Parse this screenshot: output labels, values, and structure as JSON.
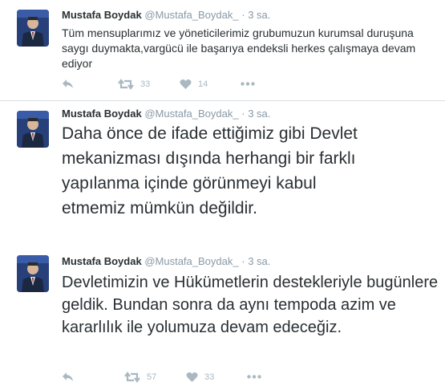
{
  "tweets": [
    {
      "name": "Mustafa Boydak",
      "handle": "@Mustafa_Boydak_",
      "dot": "·",
      "time": "3 sa.",
      "text": "Tüm mensuplarımız ve yöneticilerimiz grubumuzun kurumsal duruşuna saygı duymakta,vargücü ile başarıya endeksli herkes çalışmaya devam ediyor",
      "retweets": "33",
      "likes": "14"
    },
    {
      "name": "Mustafa Boydak",
      "handle": "@Mustafa_Boydak_",
      "dot": "·",
      "time": "3 sa.",
      "text": "Daha önce de ifade ettiğimiz gibi Devlet mekanizması dışında herhangi bir farklı yapılanma içinde görünmeyi kabul etmemiz mümkün değildir."
    },
    {
      "name": "Mustafa Boydak",
      "handle": "@Mustafa_Boydak_",
      "dot": "·",
      "time": "3 sa.",
      "text": "Devletimizin ve Hükümetlerin destekleriyle bugünlere geldik. Bundan sonra da aynı tempoda  azim ve kararlılık ile yolumuza devam edeceğiz.",
      "retweets": "57",
      "likes": "33"
    }
  ],
  "icons": {
    "reply": "reply-icon",
    "retweet": "retweet-icon",
    "like": "heart-icon",
    "more": "more-icon"
  }
}
